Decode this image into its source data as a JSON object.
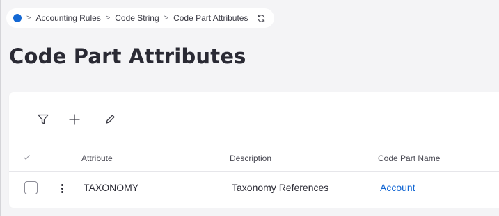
{
  "breadcrumb": {
    "items": [
      "Accounting Rules",
      "Code String",
      "Code Part Attributes"
    ]
  },
  "page": {
    "title": "Code Part Attributes"
  },
  "toolbar": {
    "icons": [
      "filter-icon",
      "add-icon",
      "edit-icon"
    ]
  },
  "table": {
    "columns": [
      "Attribute",
      "Description",
      "Code Part Name"
    ],
    "rows": [
      {
        "attribute": "TAXONOMY",
        "description": "Taxonomy References",
        "code_part_name": "Account"
      }
    ]
  },
  "colors": {
    "accent": "#1468d4",
    "background": "#f4f4f6",
    "panel": "#ffffff",
    "text": "#2a2a34"
  }
}
